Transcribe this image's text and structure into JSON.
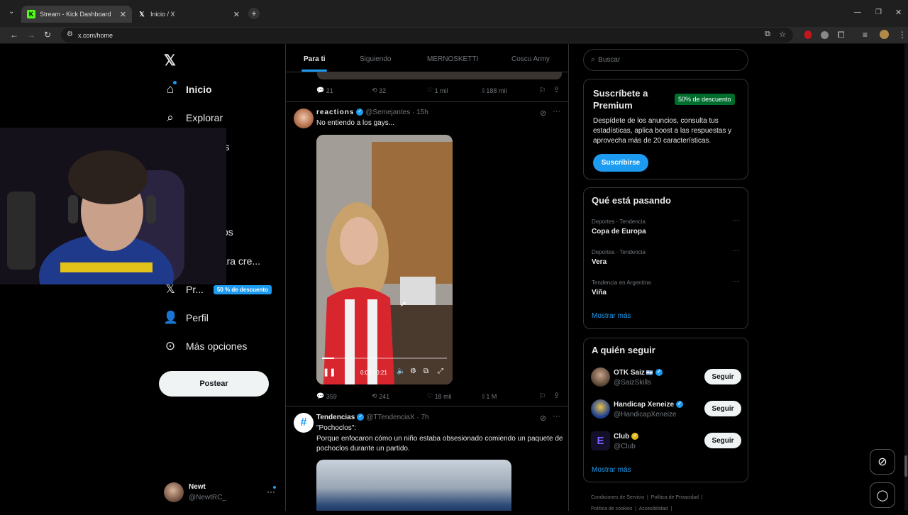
{
  "browser": {
    "tabs": [
      {
        "title": "Stream - Kick Dashboard"
      },
      {
        "title": "Inicio / X"
      }
    ],
    "url": "x.com/home"
  },
  "nav": {
    "items": [
      {
        "label": "Inicio",
        "icon": "home-icon"
      },
      {
        "label": "Explorar",
        "icon": "search-icon"
      },
      {
        "label": "iones",
        "icon": "bell-icon"
      },
      {
        "label": "os",
        "icon": "bookmark-icon"
      },
      {
        "label": "para cre...",
        "icon": "lightning-icon"
      },
      {
        "label": "Pr...",
        "icon": "x-premium-icon"
      },
      {
        "label": "Perfil",
        "icon": "person-icon"
      },
      {
        "label": "Más opciones",
        "icon": "more-circle-icon"
      }
    ],
    "premium_badge": "50 % de descuento",
    "post_button": "Postear",
    "account": {
      "name": "Newt",
      "handle": "@NewtRC_"
    }
  },
  "feed": {
    "tabs": [
      "Para ti",
      "Siguiendo",
      "MERNOSKETTI",
      "Coscu Army"
    ],
    "prev_actions": {
      "replies": "21",
      "reposts": "32",
      "likes": "1 mil",
      "views": "188 mil"
    },
    "post1": {
      "author": "reactions",
      "handle": "@Semejantes",
      "time": "15h",
      "text": "No entiendo a los gays...",
      "video_time": "0:02 / 0:21",
      "video_progress": 0.095,
      "replies": "359",
      "reposts": "241",
      "likes": "18 mil",
      "views": "1 M"
    },
    "post2": {
      "author": "Tendencias",
      "handle": "@TTendenciaX",
      "time": "7h",
      "line1": "\"Pochoclos\":",
      "line2": "Porque enfocaron cómo un niño estaba obsesionado comiendo un paquete de pochoclos durante un partido."
    }
  },
  "sidebar": {
    "search_placeholder": "Buscar",
    "premium": {
      "title": "Suscríbete a Premium",
      "badge": "50% de descuento",
      "body": "Despídete de los anuncios, consulta tus estadísticas, aplica boost a las respuestas y aprovecha más de 20 características.",
      "button": "Suscribirse"
    },
    "trends": {
      "title": "Qué está pasando",
      "items": [
        {
          "context": "Deportes · Tendencia",
          "name": "Copa de Europa"
        },
        {
          "context": "Deportes · Tendencia",
          "name": "Vera"
        },
        {
          "context": "Tendencia en Argentina",
          "name": "Viña"
        }
      ],
      "more": "Mostrar más"
    },
    "follow": {
      "title": "A quién seguir",
      "items": [
        {
          "name": "OTK Saiz",
          "handle": "@SaizSkills",
          "button": "Seguir"
        },
        {
          "name": "Handicap Xeneize",
          "handle": "@HandicapXeneize",
          "button": "Seguir"
        },
        {
          "name": "Club",
          "handle": "@Club",
          "button": "Seguir"
        }
      ],
      "more": "Mostrar más"
    },
    "footer": {
      "links": [
        "Condiciones de Servicio",
        "Política de Privacidad",
        "Política de cookies",
        "Accesibilidad"
      ]
    }
  },
  "colors": {
    "accent": "#1d9bf0",
    "background": "#000000",
    "kick_green": "#53fc18",
    "premium_green": "#006d2d"
  }
}
